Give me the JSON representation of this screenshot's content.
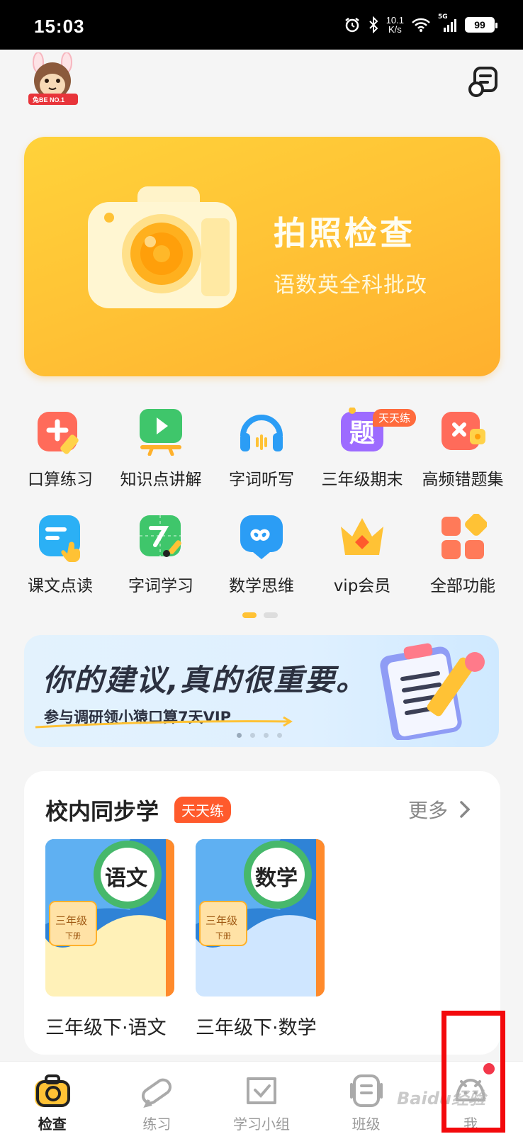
{
  "status_bar": {
    "time": "15:03",
    "net_speed_value": "10.1",
    "net_speed_unit": "K/s",
    "network": "5G",
    "battery": "99"
  },
  "header": {
    "logo_text": "兔BE NO.1",
    "logo_icon": "rabbit-monkey-mascot",
    "scan_icon": "scan-document-icon"
  },
  "banner": {
    "title": "拍照检查",
    "subtitle": "语数英全科批改",
    "icon": "camera-icon",
    "color": "#ffc235"
  },
  "functions": [
    {
      "label": "口算练习",
      "icon": "mental-math-icon",
      "color": "#ff6b5a"
    },
    {
      "label": "知识点讲解",
      "icon": "video-play-icon",
      "color": "#3fc66b"
    },
    {
      "label": "字词听写",
      "icon": "headphones-icon",
      "color": "#2b9df5"
    },
    {
      "label": "三年级期末",
      "icon": "question-icon",
      "color": "#9d6bff",
      "badge": "天天练"
    },
    {
      "label": "高频错题集",
      "icon": "wrong-questions-icon",
      "color": "#ff6b5a"
    },
    {
      "label": "课文点读",
      "icon": "point-read-icon",
      "color": "#2bb0f5"
    },
    {
      "label": "字词学习",
      "icon": "writing-icon",
      "color": "#3fc66b"
    },
    {
      "label": "数学思维",
      "icon": "infinity-icon",
      "color": "#2b9df5"
    },
    {
      "label": "vip会员",
      "icon": "crown-icon",
      "color": "#ffb12b"
    },
    {
      "label": "全部功能",
      "icon": "grid-apps-icon",
      "color": "#ff7a59"
    }
  ],
  "promo": {
    "title": "你的建议,真的很重要。",
    "subtitle": "参与调研领小猿口算7天VIP",
    "icon": "clipboard-pencil-icon"
  },
  "sync_study": {
    "title": "校内同步学",
    "badge": "天天练",
    "more": "更多",
    "books": [
      {
        "subject": "语文",
        "grade": "三年级",
        "volume": "下册",
        "label": "三年级下·语文",
        "bg": "#fff1b8"
      },
      {
        "subject": "数学",
        "grade": "三年级",
        "volume": "下册",
        "label": "三年级下·数学",
        "bg": "#cfe6ff"
      }
    ]
  },
  "tab_bar": {
    "tabs": [
      {
        "label": "检查",
        "icon": "camera-check-icon",
        "active": true
      },
      {
        "label": "练习",
        "icon": "pencil-icon",
        "active": false
      },
      {
        "label": "学习小组",
        "icon": "checkbox-group-icon",
        "active": false
      },
      {
        "label": "班级",
        "icon": "class-icon",
        "active": false
      },
      {
        "label": "我",
        "icon": "profile-face-icon",
        "active": false
      }
    ]
  },
  "watermark": "Baidu经验"
}
